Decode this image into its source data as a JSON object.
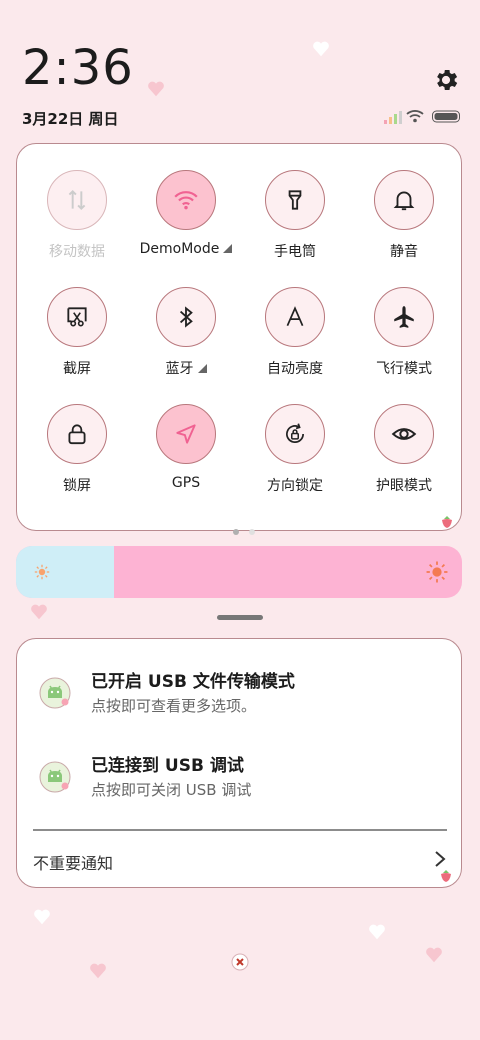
{
  "clock": {
    "time": "2:36",
    "date": "3月22日 周日"
  },
  "quick_tiles": [
    {
      "label": "移动数据",
      "icon": "mobile-data-icon",
      "state": "disabled"
    },
    {
      "label": "DemoMode",
      "icon": "wifi-icon",
      "state": "on",
      "expandable": true
    },
    {
      "label": "手电筒",
      "icon": "flashlight-icon",
      "state": "off"
    },
    {
      "label": "静音",
      "icon": "bell-icon",
      "state": "off"
    },
    {
      "label": "截屏",
      "icon": "screenshot-icon",
      "state": "off"
    },
    {
      "label": "蓝牙",
      "icon": "bluetooth-icon",
      "state": "off",
      "expandable": true
    },
    {
      "label": "自动亮度",
      "icon": "auto-brightness-icon",
      "state": "off"
    },
    {
      "label": "飞行模式",
      "icon": "airplane-icon",
      "state": "off"
    },
    {
      "label": "锁屏",
      "icon": "lock-icon",
      "state": "off"
    },
    {
      "label": "GPS",
      "icon": "gps-icon",
      "state": "on"
    },
    {
      "label": "方向锁定",
      "icon": "rotation-lock-icon",
      "state": "off"
    },
    {
      "label": "护眼模式",
      "icon": "eye-icon",
      "state": "off"
    }
  ],
  "pager": {
    "pages": 2,
    "current": 1
  },
  "brightness": {
    "level": 0.22
  },
  "notifications": {
    "items": [
      {
        "title": "已开启 USB 文件传输模式",
        "subtitle": "点按即可查看更多选项。",
        "icon": "android-debug-icon"
      },
      {
        "title": "已连接到 USB 调试",
        "subtitle": "点按即可关闭 USB 调试",
        "icon": "android-debug-icon"
      }
    ],
    "unimportant_label": "不重要通知"
  },
  "colors": {
    "background": "#fbe9ec",
    "tile_on": "#fcc2cf",
    "tile_border": "#b8777c",
    "accent": "#f06292",
    "brightness_low": "#cfeef7",
    "brightness_high": "#fdb3d3"
  }
}
